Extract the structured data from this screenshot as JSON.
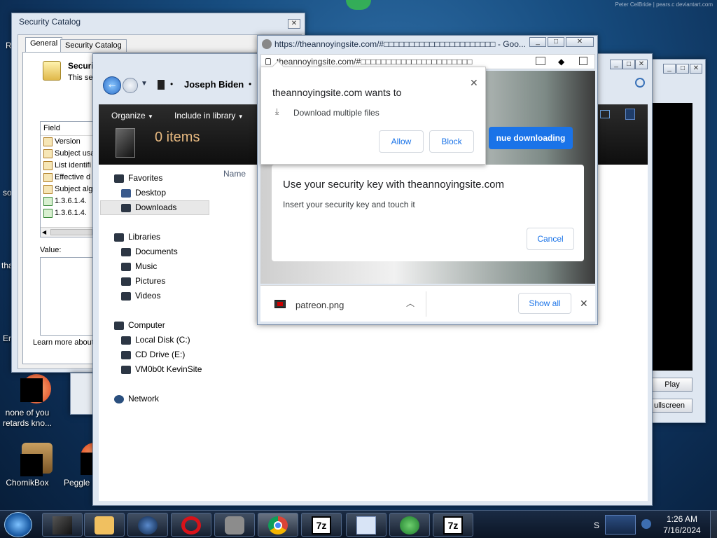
{
  "desktop": {
    "credit": "Peter CelBride | pears.c deviantart.com",
    "left_text_fragments": [
      "R",
      "so",
      "tha",
      "En"
    ],
    "icons": [
      {
        "label": "none of you retards kno..."
      },
      {
        "label": "ChomikBox"
      },
      {
        "label": "Peggle De"
      }
    ]
  },
  "security_catalog": {
    "title": "Security Catalog",
    "close": "✕",
    "tabs": [
      "General",
      "Security Catalog"
    ],
    "header_title": "Securi",
    "header_sub": "This sec",
    "field_header": "Field",
    "fields": [
      "Version",
      "Subject usa",
      "List identifi",
      "Effective d",
      "Subject alg",
      "1.3.6.1.4.",
      "1.3.6.1.4."
    ],
    "value_label": "Value:",
    "learn_more": "Learn more about"
  },
  "explorer": {
    "breadcrumb": [
      "Joseph Biden"
    ],
    "toolbar": {
      "organize": "Organize",
      "include": "Include in library"
    },
    "items_count": "0 items",
    "column_name": "Name",
    "favorites": {
      "label": "Favorites",
      "items": [
        "Desktop",
        "Downloads"
      ]
    },
    "libraries": {
      "label": "Libraries",
      "items": [
        "Documents",
        "Music",
        "Pictures",
        "Videos"
      ]
    },
    "computer": {
      "label": "Computer",
      "items": [
        "Local Disk (C:)",
        "CD Drive (E:)",
        "VM0b0t KevinSite"
      ]
    },
    "network": {
      "label": "Network"
    }
  },
  "chrome": {
    "title": "https://theannoyingsite.com/#□□□□□□□□□□□□□□□□□□□□□□ - Goo...",
    "address": "theannoyingsite.com/#□□□□□□□□□□□□□□□□□□□□□□",
    "permission": {
      "title": "theannoyingsite.com wants to",
      "item": "Download multiple files",
      "allow": "Allow",
      "block": "Block",
      "close": "✕"
    },
    "continue_downloading": "nue downloading",
    "security_key": {
      "title": "Use your security key with theannoyingsite.com",
      "body": "Insert your security key and touch it",
      "cancel": "Cancel"
    },
    "download": {
      "filename": "patreon.png",
      "show_all": "Show all",
      "close": "✕"
    }
  },
  "media_player": {
    "play": "Play",
    "fullscreen": "ullscreen"
  },
  "taskbar": {
    "time": "1:26 AM",
    "date": "7/16/2024",
    "tray_letter": "S",
    "seven_zip": "7z"
  }
}
